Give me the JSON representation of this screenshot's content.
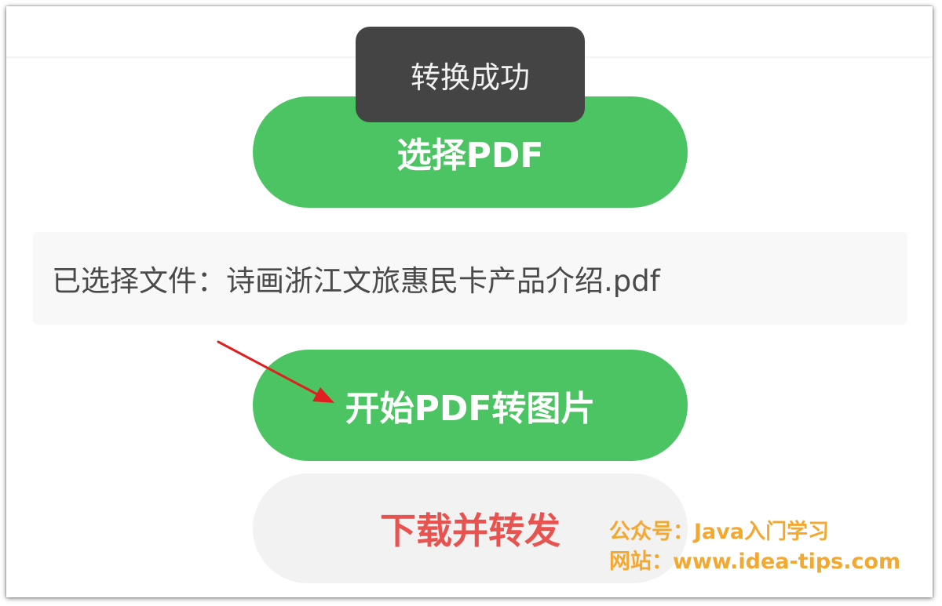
{
  "toast": {
    "text": "转换成功"
  },
  "buttons": {
    "select_pdf": "选择PDF",
    "start_convert": "开始PDF转图片",
    "download_share": "下载并转发"
  },
  "file_info": {
    "text": "已选择文件：诗画浙江文旅惠民卡产品介绍.pdf"
  },
  "watermark": {
    "line1": "公众号：Java入门学习",
    "line2": "网站：www.idea-tips.com"
  },
  "colors": {
    "primary_green": "#4cc463",
    "toast_bg": "#444444",
    "download_text": "#e8534f",
    "watermark": "#f3a832",
    "arrow": "#e02020"
  }
}
